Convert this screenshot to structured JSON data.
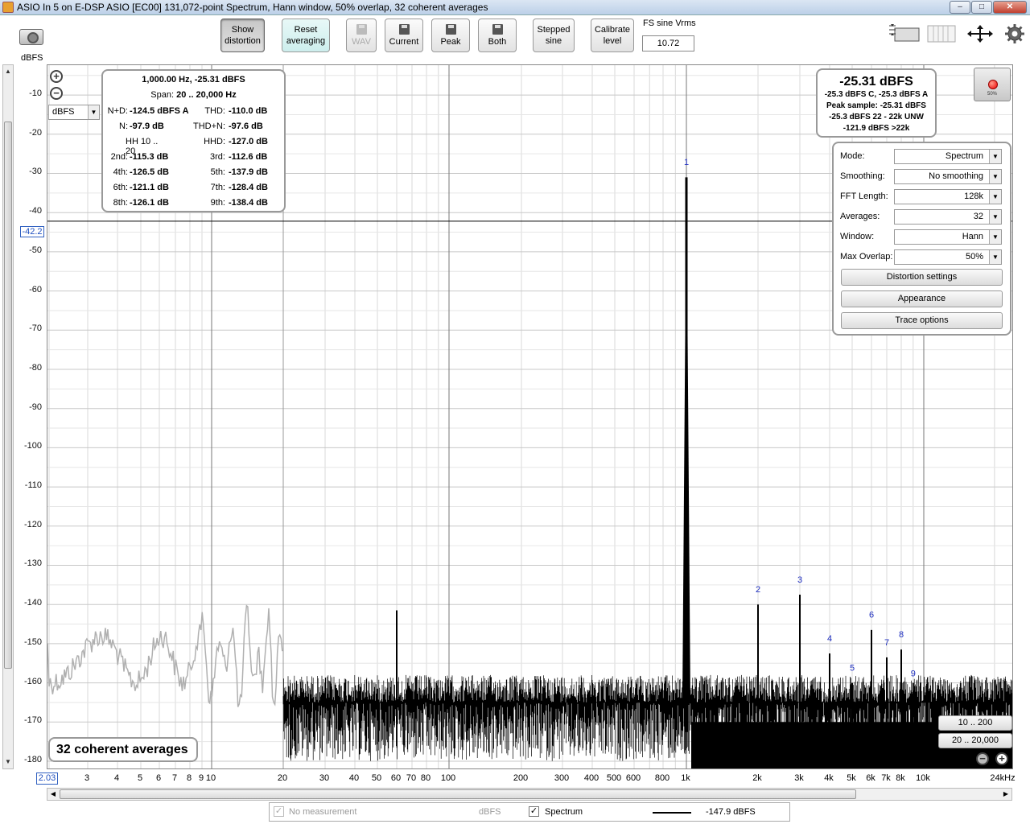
{
  "window": {
    "title": "ASIO In 5 on E-DSP ASIO [EC00] 131,072-point Spectrum, Hann window, 50% overlap, 32 coherent averages",
    "btn_min": "–",
    "btn_max": "□",
    "btn_close": "✕"
  },
  "toolbar": {
    "show_distortion": [
      "Show",
      "distortion"
    ],
    "reset_averaging": [
      "Reset",
      "averaging"
    ],
    "wav": "WAV",
    "current": "Current",
    "peak": "Peak",
    "both": "Both",
    "stepped_sine": [
      "Stepped",
      "sine"
    ],
    "calibrate_level": [
      "Calibrate",
      "level"
    ],
    "fs_sine_label": "FS sine Vrms",
    "fs_sine_value": "10.72"
  },
  "yaxis": {
    "unit": "dBFS",
    "ticks": [
      "-10",
      "-20",
      "-30",
      "-40",
      "-50",
      "-60",
      "-70",
      "-80",
      "-90",
      "-100",
      "-110",
      "-120",
      "-130",
      "-140",
      "-150",
      "-160",
      "-170",
      "-180"
    ],
    "cursor_value": "-42.2",
    "unit_select": "dBFS"
  },
  "xaxis": {
    "cursor_value": "2.03",
    "ticks": [
      "3",
      "4",
      "5",
      "6",
      "7",
      "8",
      "9",
      "10",
      "20",
      "30",
      "40",
      "50",
      "60",
      "70",
      "80",
      "100",
      "200",
      "300",
      "400",
      "500",
      "600",
      "800",
      "1k",
      "2k",
      "3k",
      "4k",
      "5k",
      "6k",
      "7k",
      "8k",
      "10k",
      "24kHz"
    ]
  },
  "distortion": {
    "header": "1,000.00 Hz, -25.31 dBFS",
    "span_label": "Span:",
    "span_value": "20 .. 20,000 Hz",
    "rows": [
      {
        "l1": "N+D:",
        "v1": "-124.5 dBFS A",
        "l2": "THD:",
        "v2": "-110.0 dB"
      },
      {
        "l1": "N:",
        "v1": "-97.9 dB",
        "l2": "THD+N:",
        "v2": "-97.6 dB"
      },
      {
        "l1": "HH 10 .. 20",
        "v1": "",
        "l2": "HHD:",
        "v2": "-127.0 dB"
      },
      {
        "l1": "2nd:",
        "v1": "-115.3 dB",
        "l2": "3rd:",
        "v2": "-112.6 dB"
      },
      {
        "l1": "4th:",
        "v1": "-126.5 dB",
        "l2": "5th:",
        "v2": "-137.9 dB"
      },
      {
        "l1": "6th:",
        "v1": "-121.1 dB",
        "l2": "7th:",
        "v2": "-128.4 dB"
      },
      {
        "l1": "8th:",
        "v1": "-126.1 dB",
        "l2": "9th:",
        "v2": "-138.4 dB"
      }
    ]
  },
  "level": {
    "big": "-25.31 dBFS",
    "lines": [
      "-25.3 dBFS C, -25.3 dBFS A",
      "Peak sample: -25.31 dBFS",
      "-25.3 dBFS 22 - 22k UNW",
      "-121.9 dBFS >22k"
    ],
    "rec_pct": "50%"
  },
  "controls": [
    {
      "label": "Mode:",
      "value": "Spectrum"
    },
    {
      "label": "Smoothing:",
      "value": "No  smoothing"
    },
    {
      "label": "FFT Length:",
      "value": "128k"
    },
    {
      "label": "Averages:",
      "value": "32"
    },
    {
      "label": "Window:",
      "value": "Hann"
    },
    {
      "label": "Max Overlap:",
      "value": "50%"
    }
  ],
  "buttons": {
    "distortion_settings": "Distortion settings",
    "appearance": "Appearance",
    "trace_options": "Trace options",
    "range_low": "10 .. 200",
    "range_full": "20 .. 20,000"
  },
  "averages_label": "32 coherent averages",
  "harmonic_labels": [
    "1",
    "2",
    "3",
    "4",
    "5",
    "6",
    "7",
    "8",
    "9"
  ],
  "status": {
    "no_measurement": "No measurement",
    "unit": "dBFS",
    "spectrum": "Spectrum",
    "value": "-147.9 dBFS"
  }
}
